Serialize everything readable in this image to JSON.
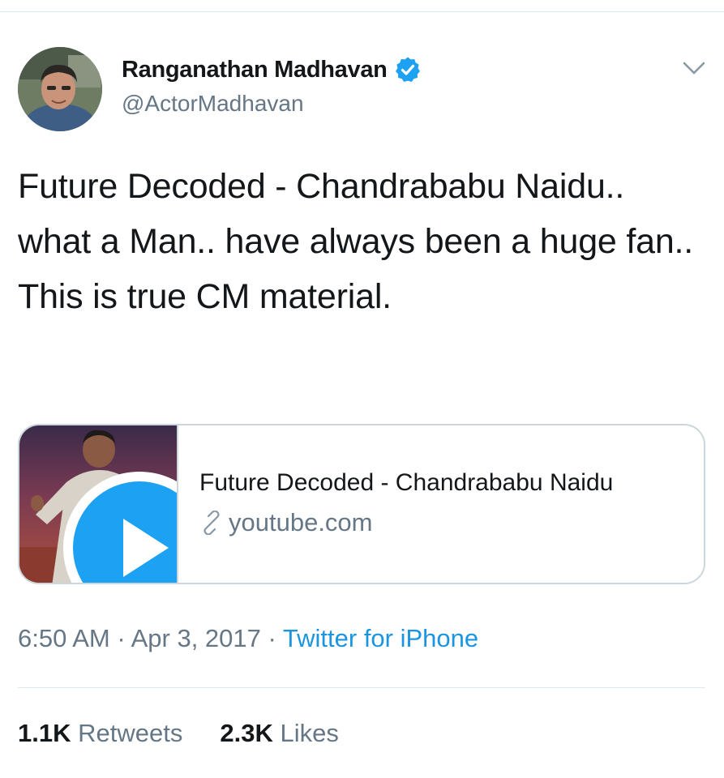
{
  "tweet": {
    "author": {
      "display_name": "Ranganathan Madhavan",
      "handle": "@ActorMadhavan",
      "verified": true
    },
    "text": "Future Decoded - Chandrababu Naidu.. what a Man.. have always been a huge fan.. This is true CM material.",
    "card": {
      "title": "Future Decoded - Chandrababu Naidu",
      "domain": "youtube.com",
      "media": "video"
    },
    "meta": {
      "time": "6:50 AM",
      "separator": "·",
      "date": "Apr 3, 2017",
      "source": "Twitter for iPhone"
    },
    "stats": {
      "retweets_count": "1.1K",
      "retweets_label": "Retweets",
      "likes_count": "2.3K",
      "likes_label": "Likes"
    }
  },
  "icons": {
    "verified": "verified-badge-icon",
    "caret": "chevron-down-icon",
    "play": "play-icon",
    "link": "link-icon"
  },
  "colors": {
    "text": "#14171a",
    "secondary": "#657786",
    "link": "#1b95e0",
    "verified": "#1da1f2",
    "border": "#ccd6dd"
  }
}
